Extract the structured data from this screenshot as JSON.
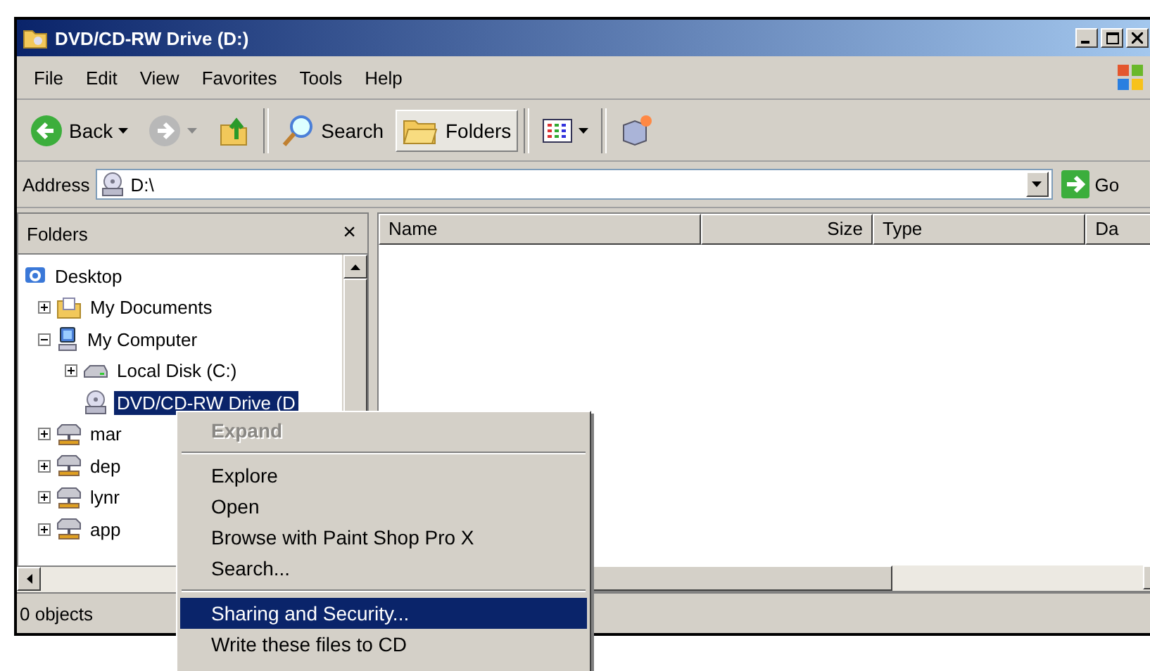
{
  "window": {
    "title": "DVD/CD-RW Drive (D:)"
  },
  "menu_bar": [
    "File",
    "Edit",
    "View",
    "Favorites",
    "Tools",
    "Help"
  ],
  "toolbar": [
    {
      "kind": "back",
      "label": "Back"
    },
    {
      "kind": "forward"
    },
    {
      "kind": "up"
    },
    {
      "kind": "separator"
    },
    {
      "kind": "search",
      "label": "Search",
      "selected": false
    },
    {
      "kind": "folders",
      "label": "Folders",
      "selected": true
    },
    {
      "kind": "separator"
    },
    {
      "kind": "views"
    },
    {
      "kind": "separator"
    },
    {
      "kind": "new"
    }
  ],
  "address": {
    "label": "Address",
    "value": "D:\\",
    "go": "Go"
  },
  "folders_pane": {
    "title": "Folders",
    "close": "×",
    "tree": [
      {
        "label": "Desktop",
        "kind": "desktop",
        "selected": false,
        "children": [
          {
            "label": "My Documents",
            "kind": "documents",
            "expanded": false,
            "selected": false
          },
          {
            "label": "My Computer",
            "kind": "computer",
            "expanded": true,
            "selected": false,
            "children": [
              {
                "label": "Local Disk (C:)",
                "kind": "disk",
                "expanded": false,
                "selected": false
              },
              {
                "label": "DVD/CD-RW Drive (D",
                "kind": "cd",
                "selected": true
              }
            ]
          },
          {
            "label": "mar",
            "kind": "network",
            "expanded": false,
            "selected": false
          },
          {
            "label": "dep",
            "kind": "network",
            "expanded": false,
            "selected": false
          },
          {
            "label": "lynr",
            "kind": "network",
            "expanded": false,
            "selected": false
          },
          {
            "label": "app",
            "kind": "network",
            "expanded": false,
            "selected": false
          }
        ]
      }
    ]
  },
  "file_list": {
    "columns": [
      "Name",
      "Size",
      "Type",
      "Da"
    ]
  },
  "status_bar": "0 objects",
  "context_menu": [
    {
      "kind": "item",
      "label": "Expand",
      "disabled": true,
      "selected": false
    },
    {
      "kind": "separator"
    },
    {
      "kind": "item",
      "label": "Explore",
      "disabled": false,
      "selected": false
    },
    {
      "kind": "item",
      "label": "Open",
      "disabled": false,
      "selected": false
    },
    {
      "kind": "item",
      "label": "Browse with Paint Shop Pro X",
      "disabled": false,
      "selected": false
    },
    {
      "kind": "item",
      "label": "Search...",
      "disabled": false,
      "selected": false
    },
    {
      "kind": "separator"
    },
    {
      "kind": "item",
      "label": "Sharing and Security...",
      "disabled": false,
      "selected": true
    },
    {
      "kind": "item",
      "label": "Write these files to CD",
      "disabled": false,
      "selected": false
    }
  ]
}
